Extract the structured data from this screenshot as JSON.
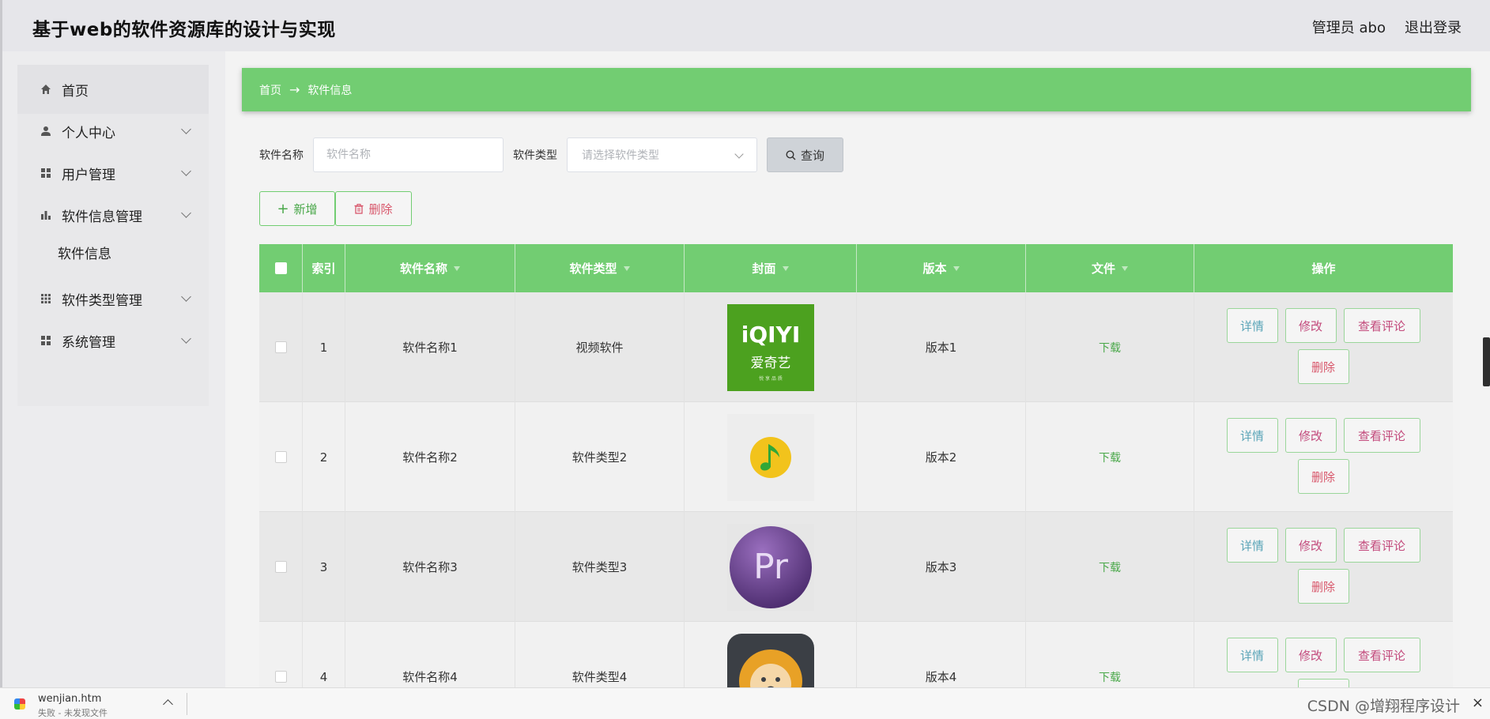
{
  "header": {
    "title": "基于web的软件资源库的设计与实现",
    "user": "管理员 abo",
    "logout": "退出登录"
  },
  "sidebar": {
    "items": [
      {
        "label": "首页",
        "icon": "home-icon"
      },
      {
        "label": "个人中心",
        "icon": "user-icon"
      },
      {
        "label": "用户管理",
        "icon": "grid-icon"
      },
      {
        "label": "软件信息管理",
        "icon": "bar-chart-icon"
      },
      {
        "label": "软件信息",
        "icon": ""
      },
      {
        "label": "软件类型管理",
        "icon": "grid9-icon"
      },
      {
        "label": "系统管理",
        "icon": "grid-icon"
      }
    ]
  },
  "breadcrumb": {
    "home": "首页",
    "arrow": "→",
    "current": "软件信息"
  },
  "search": {
    "name_label": "软件名称",
    "name_placeholder": "软件名称",
    "type_label": "软件类型",
    "type_placeholder": "请选择软件类型",
    "query_label": "查询"
  },
  "actions": {
    "add": "新增",
    "delete": "删除"
  },
  "table": {
    "columns": [
      "",
      "索引",
      "软件名称",
      "软件类型",
      "封面",
      "版本",
      "文件",
      "操作"
    ],
    "rows": [
      {
        "index": "1",
        "name": "软件名称1",
        "type": "视频软件",
        "cover": "iqiyi-logo",
        "version": "版本1",
        "file": "下载"
      },
      {
        "index": "2",
        "name": "软件名称2",
        "type": "软件类型2",
        "cover": "qq-music-logo",
        "version": "版本2",
        "file": "下载"
      },
      {
        "index": "3",
        "name": "软件名称3",
        "type": "软件类型3",
        "cover": "premiere-logo",
        "version": "版本3",
        "file": "下载"
      },
      {
        "index": "4",
        "name": "软件名称4",
        "type": "软件类型4",
        "cover": "lion-logo",
        "version": "版本4",
        "file": "下载"
      }
    ],
    "ops": {
      "detail": "详情",
      "edit": "修改",
      "review": "查看评论",
      "remove": "删除"
    }
  },
  "iqiyi": {
    "logo_text": "iQIYI",
    "cn_text": "爱奇艺",
    "tagline": "悦 享 品 质"
  },
  "premiere": {
    "logo_text": "Pr"
  },
  "download_bar": {
    "filename": "wenjian.htm",
    "status": "失败 - 未发现文件",
    "watermark": "CSDN @增翔程序设计",
    "close": "×"
  },
  "colors": {
    "accent": "#72cd72",
    "danger": "#d8576b",
    "edit": "#c34a7c",
    "detail": "#5aa5b8"
  }
}
